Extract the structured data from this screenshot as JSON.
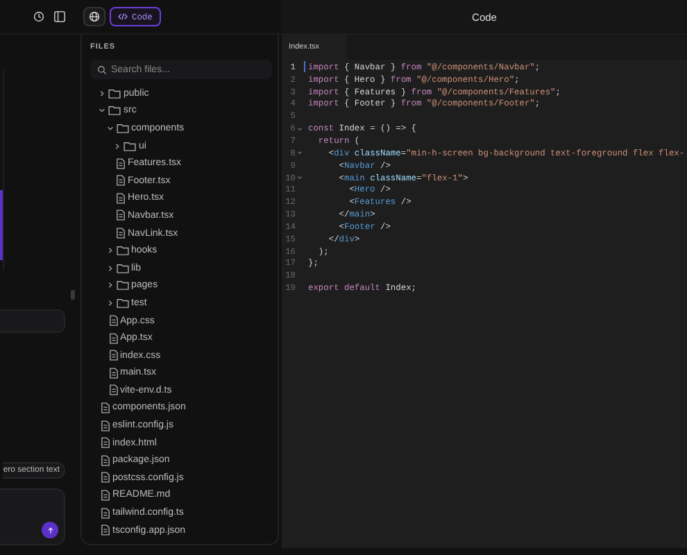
{
  "chat": {
    "suggestion": "ero section text"
  },
  "views": [
    {
      "kind": "preview",
      "selected": false
    },
    {
      "kind": "code",
      "label": "Code",
      "selected": true
    }
  ],
  "title": "Code",
  "files": {
    "heading": "FILES",
    "search": {
      "placeholder": "Search files..."
    },
    "tree": [
      {
        "name": "public",
        "kind": "folder",
        "expanded": false
      },
      {
        "name": "src",
        "kind": "folder",
        "expanded": true,
        "children": [
          {
            "name": "components",
            "kind": "folder",
            "expanded": true,
            "children": [
              {
                "name": "ui",
                "kind": "folder",
                "expanded": false
              },
              {
                "name": "Features.tsx",
                "kind": "file"
              },
              {
                "name": "Footer.tsx",
                "kind": "file"
              },
              {
                "name": "Hero.tsx",
                "kind": "file"
              },
              {
                "name": "Navbar.tsx",
                "kind": "file"
              },
              {
                "name": "NavLink.tsx",
                "kind": "file"
              }
            ]
          },
          {
            "name": "hooks",
            "kind": "folder",
            "expanded": false
          },
          {
            "name": "lib",
            "kind": "folder",
            "expanded": false
          },
          {
            "name": "pages",
            "kind": "folder",
            "expanded": false
          },
          {
            "name": "test",
            "kind": "folder",
            "expanded": false
          },
          {
            "name": "App.css",
            "kind": "file"
          },
          {
            "name": "App.tsx",
            "kind": "file"
          },
          {
            "name": "index.css",
            "kind": "file"
          },
          {
            "name": "main.tsx",
            "kind": "file"
          },
          {
            "name": "vite-env.d.ts",
            "kind": "file"
          }
        ]
      },
      {
        "name": "components.json",
        "kind": "file"
      },
      {
        "name": "eslint.config.js",
        "kind": "file"
      },
      {
        "name": "index.html",
        "kind": "file"
      },
      {
        "name": "package.json",
        "kind": "file"
      },
      {
        "name": "postcss.config.js",
        "kind": "file"
      },
      {
        "name": "README.md",
        "kind": "file"
      },
      {
        "name": "tailwind.config.ts",
        "kind": "file"
      },
      {
        "name": "tsconfig.app.json",
        "kind": "file"
      }
    ]
  },
  "editor": {
    "tabs": [
      {
        "label": "Index.tsx",
        "selected": true
      }
    ],
    "lines": [
      {
        "number": "1",
        "current": true,
        "foldable": false,
        "tokens": [
          {
            "kind": "keyword",
            "text": "import"
          },
          {
            "kind": "plain",
            "text": " { Navbar } "
          },
          {
            "kind": "keyword",
            "text": "from"
          },
          {
            "kind": "string",
            "text": " \"@/components/Navbar\""
          },
          {
            "kind": "plain",
            "text": ";"
          }
        ]
      },
      {
        "number": "2",
        "current": false,
        "foldable": false,
        "tokens": [
          {
            "kind": "keyword",
            "text": "import"
          },
          {
            "kind": "plain",
            "text": " { Hero } "
          },
          {
            "kind": "keyword",
            "text": "from"
          },
          {
            "kind": "string",
            "text": " \"@/components/Hero\""
          },
          {
            "kind": "plain",
            "text": ";"
          }
        ]
      },
      {
        "number": "3",
        "current": false,
        "foldable": false,
        "tokens": [
          {
            "kind": "keyword",
            "text": "import"
          },
          {
            "kind": "plain",
            "text": " { Features } "
          },
          {
            "kind": "keyword",
            "text": "from"
          },
          {
            "kind": "string",
            "text": " \"@/components/Features\""
          },
          {
            "kind": "plain",
            "text": ";"
          }
        ]
      },
      {
        "number": "4",
        "current": false,
        "foldable": false,
        "tokens": [
          {
            "kind": "keyword",
            "text": "import"
          },
          {
            "kind": "plain",
            "text": " { Footer } "
          },
          {
            "kind": "keyword",
            "text": "from"
          },
          {
            "kind": "string",
            "text": " \"@/components/Footer\""
          },
          {
            "kind": "plain",
            "text": ";"
          }
        ]
      },
      {
        "number": "5",
        "current": false,
        "foldable": false
      },
      {
        "number": "6",
        "current": false,
        "foldable": true,
        "tokens": [
          {
            "kind": "keyword",
            "text": "const"
          },
          {
            "kind": "plain",
            "text": " Index = () => {"
          }
        ]
      },
      {
        "number": "7",
        "current": false,
        "foldable": false,
        "tokens": [
          {
            "kind": "keyword",
            "text": "  return"
          },
          {
            "kind": "plain",
            "text": " ("
          }
        ]
      },
      {
        "number": "8",
        "current": false,
        "foldable": true,
        "tokens": [
          {
            "kind": "plain",
            "text": "    <"
          },
          {
            "kind": "tag",
            "text": "div"
          },
          {
            "kind": "attr",
            "text": " className"
          },
          {
            "kind": "plain",
            "text": "="
          },
          {
            "kind": "string",
            "text": "\"min-h-screen bg-background text-foreground flex flex-"
          }
        ]
      },
      {
        "number": "9",
        "current": false,
        "foldable": false,
        "tokens": [
          {
            "kind": "plain",
            "text": "      <"
          },
          {
            "kind": "tag",
            "text": "Navbar"
          },
          {
            "kind": "plain",
            "text": " />"
          }
        ]
      },
      {
        "number": "10",
        "current": false,
        "foldable": true,
        "tokens": [
          {
            "kind": "plain",
            "text": "      <"
          },
          {
            "kind": "tag",
            "text": "main"
          },
          {
            "kind": "attr",
            "text": " className"
          },
          {
            "kind": "plain",
            "text": "="
          },
          {
            "kind": "string",
            "text": "\"flex-1\""
          },
          {
            "kind": "plain",
            "text": ">"
          }
        ]
      },
      {
        "number": "11",
        "current": false,
        "foldable": false,
        "tokens": [
          {
            "kind": "plain",
            "text": "        <"
          },
          {
            "kind": "tag",
            "text": "Hero"
          },
          {
            "kind": "plain",
            "text": " />"
          }
        ]
      },
      {
        "number": "12",
        "current": false,
        "foldable": false,
        "tokens": [
          {
            "kind": "plain",
            "text": "        <"
          },
          {
            "kind": "tag",
            "text": "Features"
          },
          {
            "kind": "plain",
            "text": " />"
          }
        ]
      },
      {
        "number": "13",
        "current": false,
        "foldable": false,
        "tokens": [
          {
            "kind": "plain",
            "text": "      </"
          },
          {
            "kind": "tag",
            "text": "main"
          },
          {
            "kind": "plain",
            "text": ">"
          }
        ]
      },
      {
        "number": "14",
        "current": false,
        "foldable": false,
        "tokens": [
          {
            "kind": "plain",
            "text": "      <"
          },
          {
            "kind": "tag",
            "text": "Footer"
          },
          {
            "kind": "plain",
            "text": " />"
          }
        ]
      },
      {
        "number": "15",
        "current": false,
        "foldable": false,
        "tokens": [
          {
            "kind": "plain",
            "text": "    </"
          },
          {
            "kind": "tag",
            "text": "div"
          },
          {
            "kind": "plain",
            "text": ">"
          }
        ]
      },
      {
        "number": "16",
        "current": false,
        "foldable": false,
        "tokens": [
          {
            "kind": "plain",
            "text": "  );"
          }
        ]
      },
      {
        "number": "17",
        "current": false,
        "foldable": false,
        "tokens": [
          {
            "kind": "plain",
            "text": "};"
          }
        ]
      },
      {
        "number": "18",
        "current": false,
        "foldable": false
      },
      {
        "number": "19",
        "current": false,
        "foldable": false,
        "tokens": [
          {
            "kind": "keyword",
            "text": "export"
          },
          {
            "kind": "keyword",
            "text": " default"
          },
          {
            "kind": "plain",
            "text": " Index;"
          }
        ]
      }
    ]
  }
}
